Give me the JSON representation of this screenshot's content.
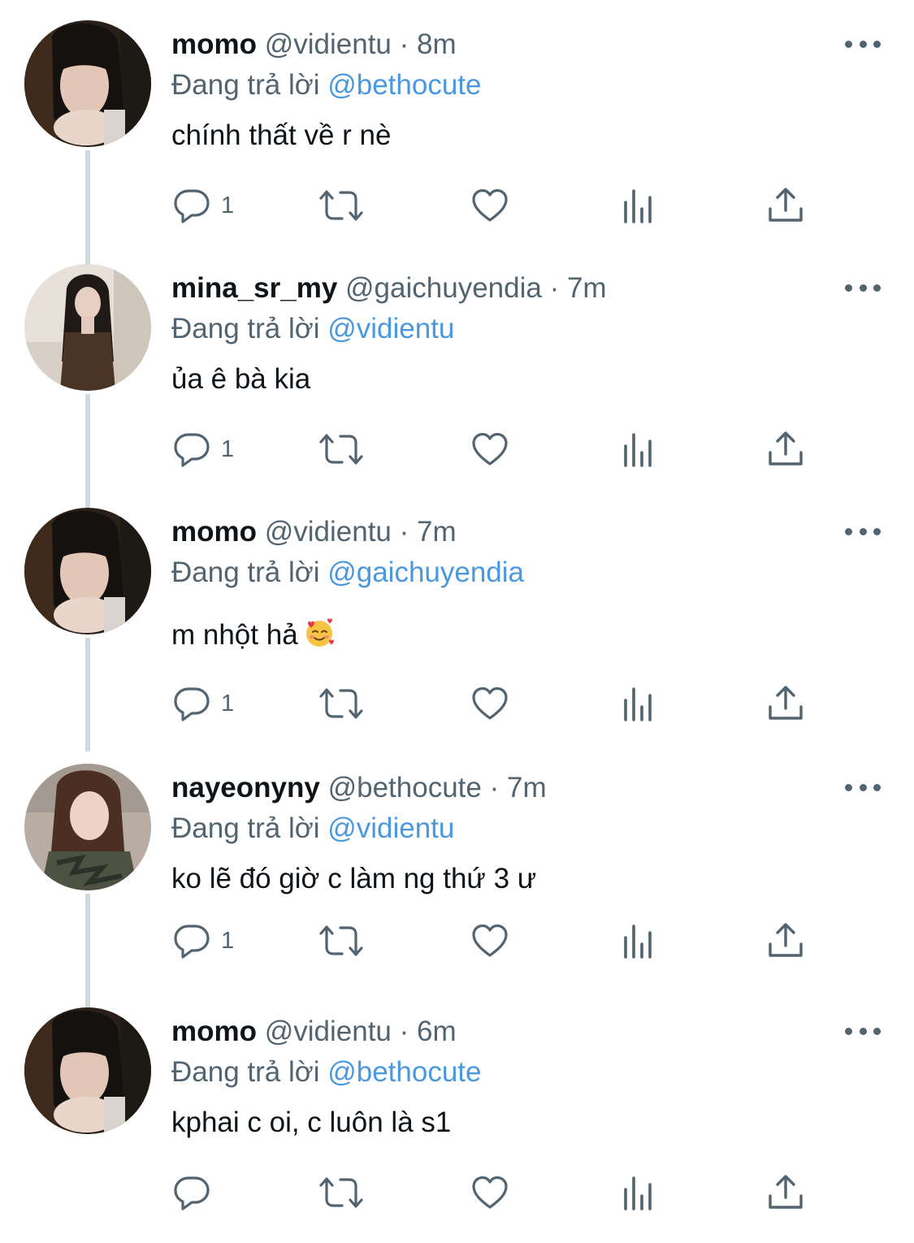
{
  "colors": {
    "text": "#0f1419",
    "secondary": "#536471",
    "mention": "#4a98e0",
    "thread_line": "#cfd9de"
  },
  "icons": {
    "reply": "speech-bubble-icon",
    "retweet": "retweet-arrows-icon",
    "like": "heart-icon",
    "views": "bar-chart-icon",
    "share": "upload-arrow-icon",
    "more": "three-dots-icon"
  },
  "tweets": [
    {
      "display_name": "momo",
      "handle": "@vidientu",
      "separator": "·",
      "time": "8m",
      "replying_prefix": "Đang trả lời",
      "replying_to": "@bethocute",
      "text": "chính thất về r nè",
      "emoji": "",
      "reply_count": "1"
    },
    {
      "display_name": "mina_sr_my",
      "handle": "@gaichuyendia",
      "separator": "·",
      "time": "7m",
      "replying_prefix": "Đang trả lời",
      "replying_to": "@vidientu",
      "text": "ủa ê bà kia",
      "emoji": "",
      "reply_count": "1"
    },
    {
      "display_name": "momo",
      "handle": "@vidientu",
      "separator": "·",
      "time": "7m",
      "replying_prefix": "Đang trả lời",
      "replying_to": "@gaichuyendia",
      "text": "m nhột hả",
      "emoji": "🥰",
      "reply_count": "1"
    },
    {
      "display_name": "nayeonyny",
      "handle": "@bethocute",
      "separator": "·",
      "time": "7m",
      "replying_prefix": "Đang trả lời",
      "replying_to": "@vidientu",
      "text": "ko lẽ đó giờ c làm ng thứ 3 ư",
      "emoji": "",
      "reply_count": "1"
    },
    {
      "display_name": "momo",
      "handle": "@vidientu",
      "separator": "·",
      "time": "6m",
      "replying_prefix": "Đang trả lời",
      "replying_to": "@bethocute",
      "text": "kphai c oi, c luôn là s1",
      "emoji": "",
      "reply_count": ""
    }
  ]
}
